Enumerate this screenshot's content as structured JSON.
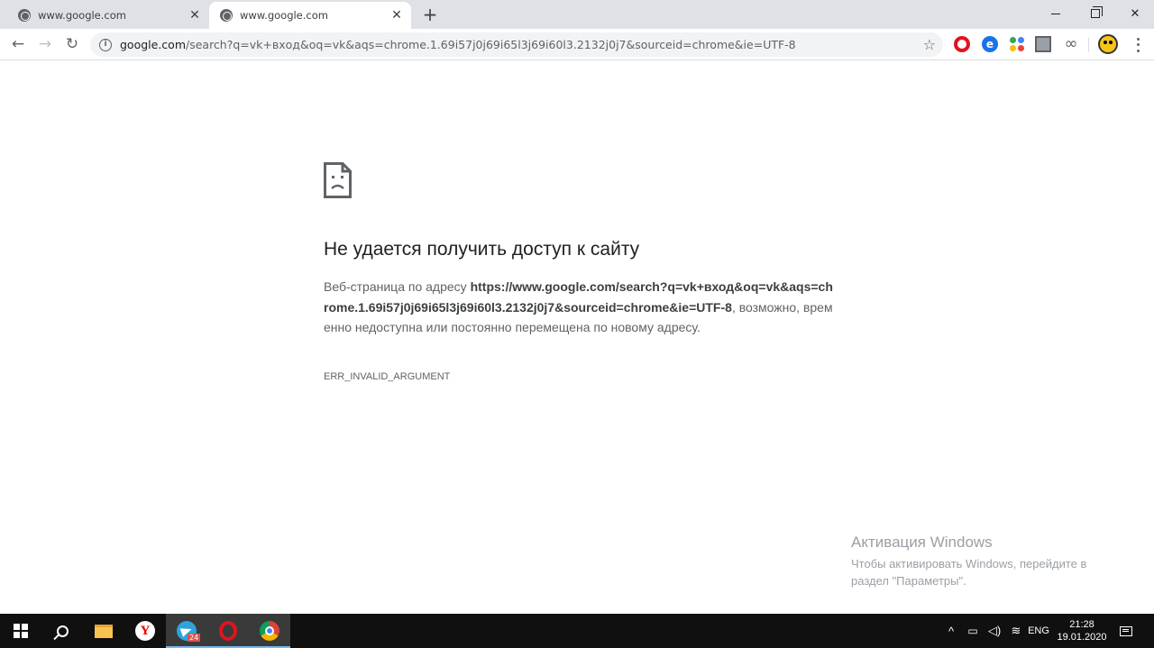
{
  "tabs": [
    {
      "title": "www.google.com",
      "close": "✕"
    },
    {
      "title": "www.google.com",
      "close": "✕"
    }
  ],
  "window_controls": {
    "min": "",
    "max": "",
    "close": "✕"
  },
  "toolbar": {
    "back": "←",
    "forward": "→",
    "reload": "↻",
    "new_tab": "+",
    "info_glyph": "i",
    "star": "☆"
  },
  "omnibox": {
    "host": "google.com",
    "path": "/search?q=vk+вход&oq=vk&aqs=chrome.1.69i57j0j69i65l3j69i60l3.2132j0j7&sourceid=chrome&ie=UTF-8"
  },
  "extensions": {
    "e_glyph": "e",
    "infinity": "∞"
  },
  "error": {
    "title": "Не удается получить доступ к сайту",
    "body_prefix": "Веб-страница по адресу ",
    "body_url": "https://www.google.com/search?q=vk+вход&oq=vk&aqs=chrome.1.69i57j0j69i65l3j69i60l3.2132j0j7&sourceid=chrome&ie=UTF-8",
    "body_suffix": ", возможно, временно недоступна или постоянно перемещена по новому адресу.",
    "code": "ERR_INVALID_ARGUMENT"
  },
  "activation": {
    "title": "Активация Windows",
    "text": "Чтобы активировать Windows, перейдите в раздел \"Параметры\"."
  },
  "taskbar": {
    "yandex_glyph": "Y",
    "telegram_badge": "24",
    "tray_chevron": "^",
    "tray_battery": "▭",
    "tray_volume": "◁)",
    "tray_wifi": "≋",
    "lang": "ENG",
    "time": "21:28",
    "date": "19.01.2020"
  },
  "colors": {
    "error_code_red": "#e0141e",
    "accent": "#76b9ed"
  }
}
